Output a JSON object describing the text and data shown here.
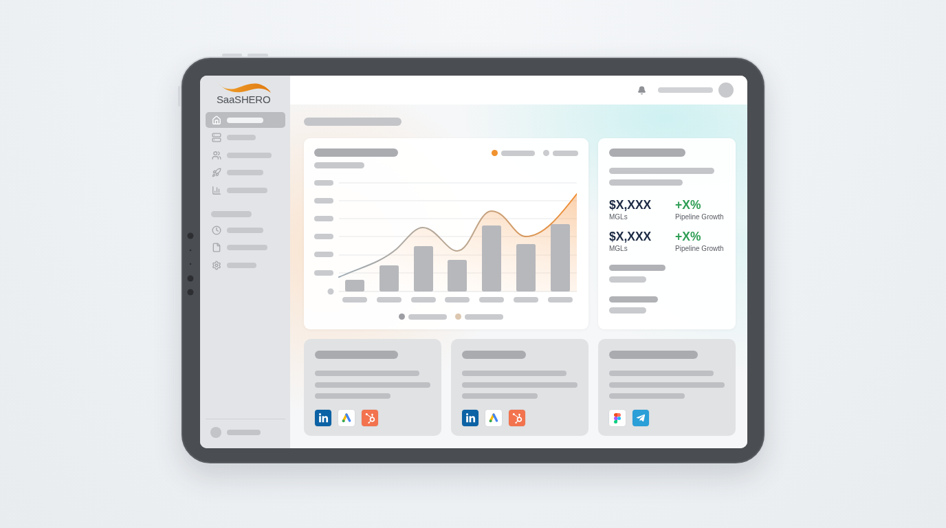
{
  "sidebar": {
    "logo": "SaaSHERO",
    "nav_items": [
      {
        "selected": true
      },
      {
        "selected": false
      },
      {
        "selected": false
      },
      {
        "selected": false
      },
      {
        "selected": false
      }
    ],
    "secondary_items": [
      {
        "selected": false
      },
      {
        "selected": false
      },
      {
        "selected": false
      }
    ]
  },
  "chart_card": {
    "legend": [
      {
        "color": "#f0922e"
      },
      {
        "color": "#c9cbce"
      }
    ],
    "footer_legend": [
      {
        "color": "#9c9ea3"
      },
      {
        "color": "#dcc7b0"
      }
    ]
  },
  "stats_card": {
    "stats": [
      {
        "kind": "amount",
        "value": "$X,XXX",
        "label": "MGLs"
      },
      {
        "kind": "growth",
        "value": "+X%",
        "label": "Pipeline Growth"
      },
      {
        "kind": "amount",
        "value": "$X,XXX",
        "label": "MGLs"
      },
      {
        "kind": "growth",
        "value": "+X%",
        "label": "Pipeline Growth"
      }
    ]
  },
  "integration_cards": [
    {
      "icons": [
        {
          "kind": "linkedin"
        },
        {
          "kind": "googleads"
        },
        {
          "kind": "hubspot"
        }
      ]
    },
    {
      "icons": [
        {
          "kind": "linkedin"
        },
        {
          "kind": "googleads"
        },
        {
          "kind": "hubspot"
        }
      ]
    },
    {
      "icons": [
        {
          "kind": "figma"
        },
        {
          "kind": "telegram"
        }
      ]
    }
  ]
}
